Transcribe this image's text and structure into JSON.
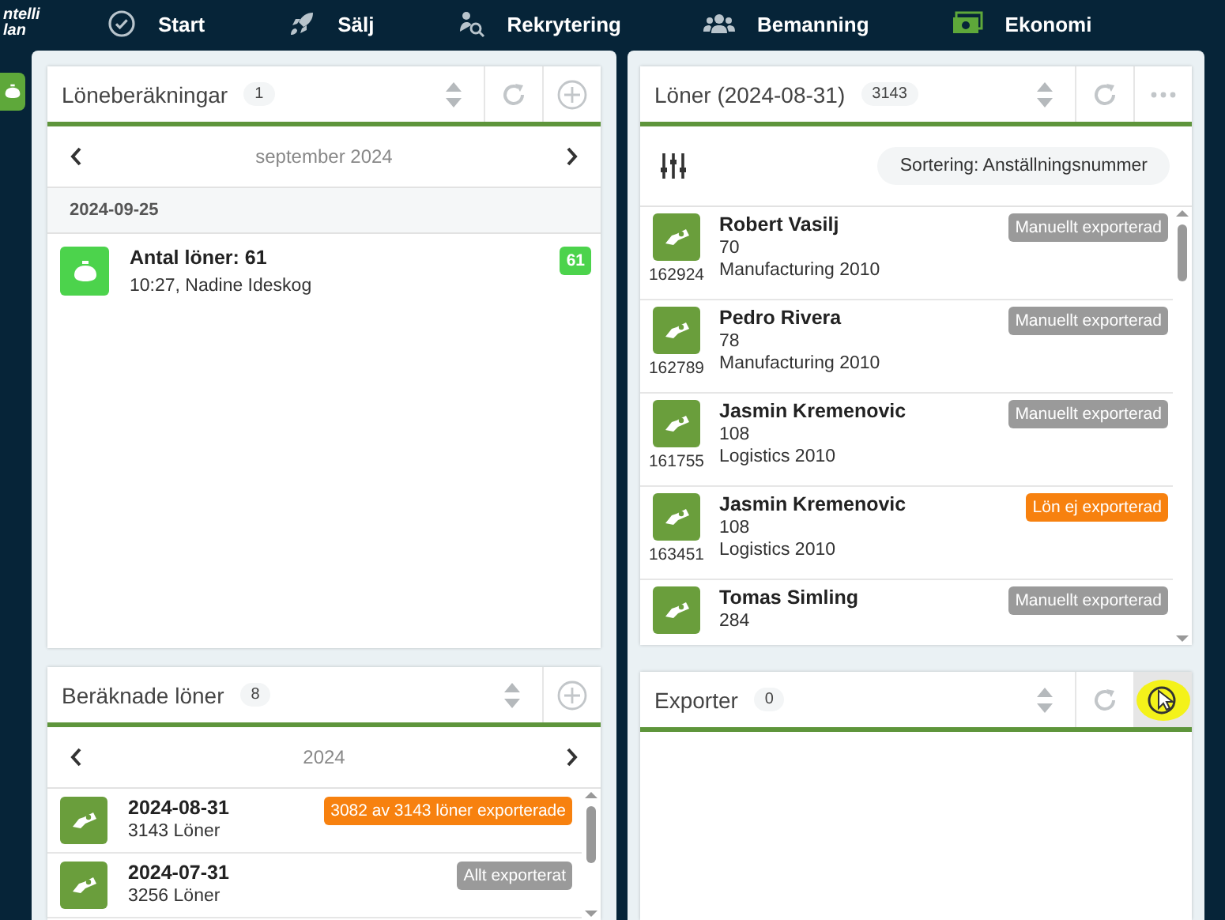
{
  "top_bar": {
    "logo": [
      "ntelli",
      "lan"
    ],
    "items": [
      {
        "label": "Start",
        "selected": false
      },
      {
        "label": "Sälj",
        "selected": false
      },
      {
        "label": "Rekrytering",
        "selected": false
      },
      {
        "label": "Bemanning",
        "selected": false
      },
      {
        "label": "Ekonomi",
        "selected": true
      }
    ]
  },
  "sidebar": {
    "items": [
      {
        "selected": true
      }
    ]
  },
  "columns": [
    {
      "panels": [
        {
          "kind": "calc",
          "title": "Löneberäkningar",
          "count": "1",
          "buttons": [
            {
              "kind": "sort"
            },
            {
              "kind": "refresh"
            },
            {
              "kind": "add"
            }
          ],
          "period": "september 2024",
          "groups": [
            {
              "date": "2024-09-25",
              "items": [
                {
                  "title": "Antal löner: 61",
                  "subtitle": "10:27, Nadine Ideskog",
                  "badge": "61"
                }
              ]
            }
          ]
        },
        {
          "kind": "calculated",
          "title": "Beräknade löner",
          "count": "8",
          "buttons": [
            {
              "kind": "sort"
            },
            {
              "kind": "add"
            }
          ],
          "period": "2024",
          "rows": [
            {
              "date": "2024-08-31",
              "count": "3143 Löner",
              "status": "3082 av 3143 löner exporterade",
              "kind": "partial"
            },
            {
              "date": "2024-07-31",
              "count": "3256 Löner",
              "status": "Allt exporterat",
              "kind": "done"
            }
          ]
        }
      ]
    },
    {
      "panels": [
        {
          "kind": "salaries",
          "title": "Löner (2024-08-31)",
          "count": "3143",
          "buttons": [
            {
              "kind": "sort"
            },
            {
              "kind": "refresh"
            },
            {
              "kind": "more"
            }
          ],
          "sorting": "Sortering: Anställningsnummer",
          "rows": [
            {
              "name": "Robert Vasilj",
              "number": "70",
              "department": "Manufacturing 2010",
              "id": "162924",
              "status": "Manuellt exporterad",
              "kind": "manual"
            },
            {
              "name": "Pedro Rivera",
              "number": "78",
              "department": "Manufacturing 2010",
              "id": "162789",
              "status": "Manuellt exporterad",
              "kind": "manual"
            },
            {
              "name": "Jasmin Kremenovic",
              "number": "108",
              "department": "Logistics 2010",
              "id": "161755",
              "status": "Manuellt exporterad",
              "kind": "manual"
            },
            {
              "name": "Jasmin Kremenovic",
              "number": "108",
              "department": "Logistics 2010",
              "id": "163451",
              "status": "Lön ej exporterad",
              "kind": "not_exported"
            },
            {
              "name": "Tomas Simling",
              "number": "284",
              "status": "Manuellt exporterad",
              "kind": "manual"
            }
          ]
        },
        {
          "kind": "exports",
          "title": "Exporter",
          "count": "0",
          "buttons": [
            {
              "kind": "sort"
            },
            {
              "kind": "refresh"
            },
            {
              "kind": "cursor"
            }
          ]
        }
      ]
    }
  ]
}
